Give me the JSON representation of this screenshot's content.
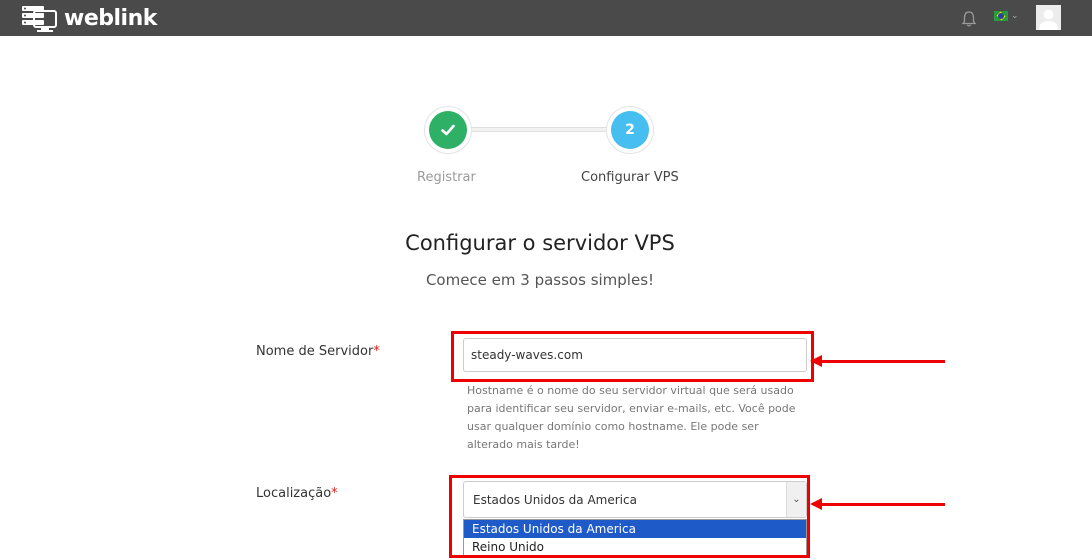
{
  "header": {
    "logo_text": "weblink",
    "bg_color": "#4a4a4a",
    "icons": [
      "bell-icon",
      "brazil-flag-icon",
      "chevron-down-icon",
      "user-avatar-icon"
    ]
  },
  "stepper": {
    "steps": [
      {
        "number": "✓",
        "label": "Registrar",
        "status": "done",
        "color": "#2fb067"
      },
      {
        "number": "2",
        "label": "Configurar VPS",
        "status": "active",
        "color": "#46bff0"
      }
    ]
  },
  "page": {
    "title": "Configurar o servidor VPS",
    "subtitle": "Comece em 3 passos simples!"
  },
  "form": {
    "server_name": {
      "label": "Nome de Servidor",
      "required_mark": "*",
      "value": "steady-waves.com",
      "help": "Hostname é o nome do seu servidor virtual que será usado para identificar seu servidor, enviar e-mails, etc. Você pode usar qualquer domínio como hostname. Ele pode ser alterado mais tarde!"
    },
    "location": {
      "label": "Localização",
      "required_mark": "*",
      "selected": "Estados Unidos da America",
      "options": [
        "Estados Unidos da America",
        "Reino Unido"
      ]
    }
  },
  "annotations": {
    "highlight_color": "#e00000"
  }
}
